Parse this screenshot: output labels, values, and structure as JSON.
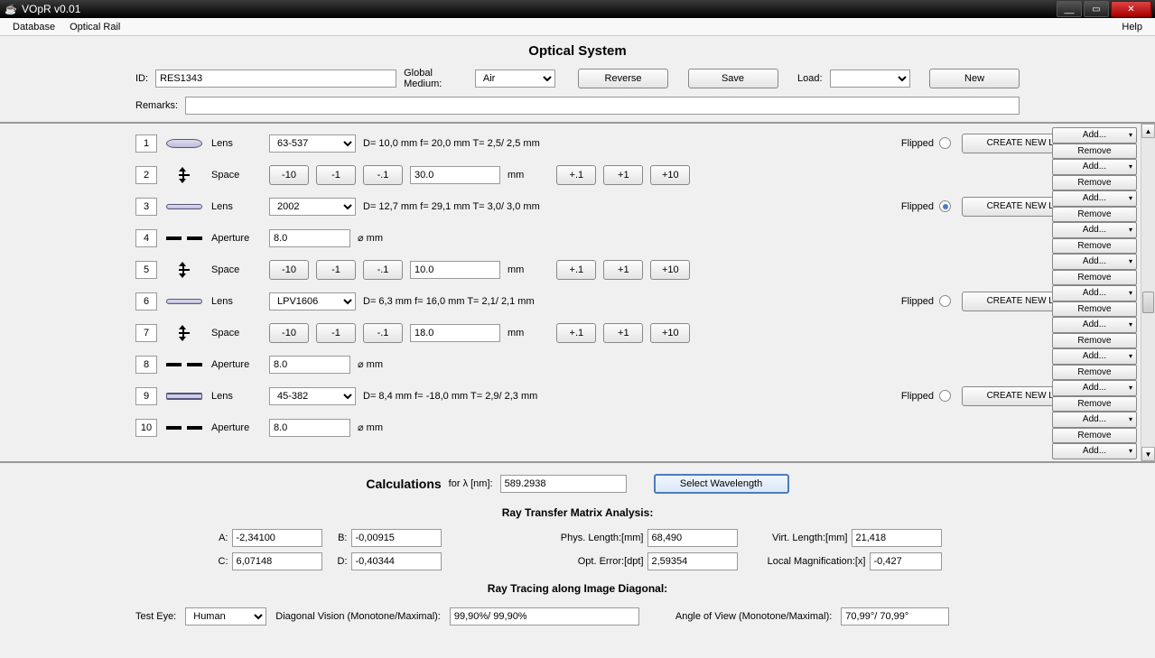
{
  "window": {
    "title": "VOpR v0.01"
  },
  "menu": {
    "database": "Database",
    "optical_rail": "Optical Rail",
    "help": "Help"
  },
  "header": {
    "title": "Optical System",
    "id_label": "ID:",
    "id_value": "RES1343",
    "medium_label": "Global Medium:",
    "medium_value": "Air",
    "reverse": "Reverse",
    "save": "Save",
    "load": "Load:",
    "new": "New",
    "remarks_label": "Remarks:",
    "remarks_value": ""
  },
  "side": {
    "add": "Add...",
    "remove": "Remove"
  },
  "rows": [
    {
      "n": "1",
      "type": "lens",
      "sel": "63-537",
      "info": "D=  10,0 mm  f=  20,0 mm  T=   2,5/  2,5 mm",
      "flipped": false
    },
    {
      "n": "2",
      "type": "space",
      "val": "30.0"
    },
    {
      "n": "3",
      "type": "lens",
      "sel": "2002",
      "info": "D=  12,7 mm  f=  29,1 mm  T=   3,0/  3,0 mm",
      "flipped": true,
      "lensStyle": "flat"
    },
    {
      "n": "4",
      "type": "aperture",
      "val": "8.0"
    },
    {
      "n": "5",
      "type": "space",
      "val": "10.0"
    },
    {
      "n": "6",
      "type": "lens",
      "sel": "LPV1606",
      "info": "D=   6,3 mm  f=  16,0 mm  T=   2,1/  2,1 mm",
      "flipped": false,
      "lensStyle": "flat"
    },
    {
      "n": "7",
      "type": "space",
      "val": "18.0"
    },
    {
      "n": "8",
      "type": "aperture",
      "val": "8.0"
    },
    {
      "n": "9",
      "type": "lens",
      "sel": "45-382",
      "info": "D=   8,4 mm  f= -18,0 mm  T=   2,9/  2,3 mm",
      "flipped": false,
      "lensStyle": "concave"
    },
    {
      "n": "10",
      "type": "aperture",
      "val": "8.0"
    }
  ],
  "rowlabels": {
    "lens": "Lens",
    "space": "Space",
    "aperture": "Aperture",
    "flipped": "Flipped",
    "create": "CREATE NEW LENS",
    "mm": "mm",
    "diam": "⌀ mm",
    "m10": "-10",
    "m1": "-1",
    "md1": "-.1",
    "pd1": "+.1",
    "p1": "+1",
    "p10": "+10"
  },
  "calc": {
    "title": "Calculations",
    "for": "for λ [nm]:",
    "lambda": "589.2938",
    "select": "Select Wavelength",
    "rtma": "Ray Transfer Matrix Analysis:",
    "A_l": "A:",
    "A": "-2,34100",
    "B_l": "B:",
    "B": "-0,00915",
    "C_l": "C:",
    "C": "6,07148",
    "D_l": "D:",
    "D": "-0,40344",
    "pl_l": "Phys. Length:[mm]",
    "pl": "68,490",
    "vl_l": "Virt. Length:[mm]",
    "vl": "21,418",
    "oe_l": "Opt. Error:[dpt]",
    "oe": "2,59354",
    "lm_l": "Local Magnification:[x]",
    "lm": "-0,427",
    "rtid": "Ray Tracing along Image Diagonal:",
    "te_l": "Test Eye:",
    "te": "Human",
    "dv_l": "Diagonal Vision (Monotone/Maximal):",
    "dv": "99,90%/ 99,90%",
    "av_l": "Angle of View (Monotone/Maximal):",
    "av": "70,99°/ 70,99°"
  }
}
